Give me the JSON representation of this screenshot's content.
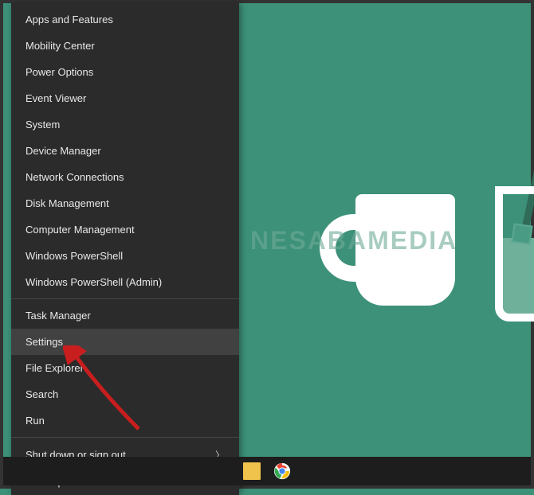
{
  "menu": {
    "group1": [
      "Apps and Features",
      "Mobility Center",
      "Power Options",
      "Event Viewer",
      "System",
      "Device Manager",
      "Network Connections",
      "Disk Management",
      "Computer Management",
      "Windows PowerShell",
      "Windows PowerShell (Admin)"
    ],
    "group2": [
      "Task Manager",
      "Settings",
      "File Explorer",
      "Search",
      "Run"
    ],
    "group3": {
      "shutdown": "Shut down or sign out",
      "desktop": "Desktop"
    },
    "highlighted": "Settings"
  },
  "watermark": "NESABAMEDIA",
  "colors": {
    "desktop_bg": "#3d9179",
    "menu_bg": "#2b2b2b",
    "menu_hover": "#414141",
    "arrow": "#c81e1e"
  }
}
